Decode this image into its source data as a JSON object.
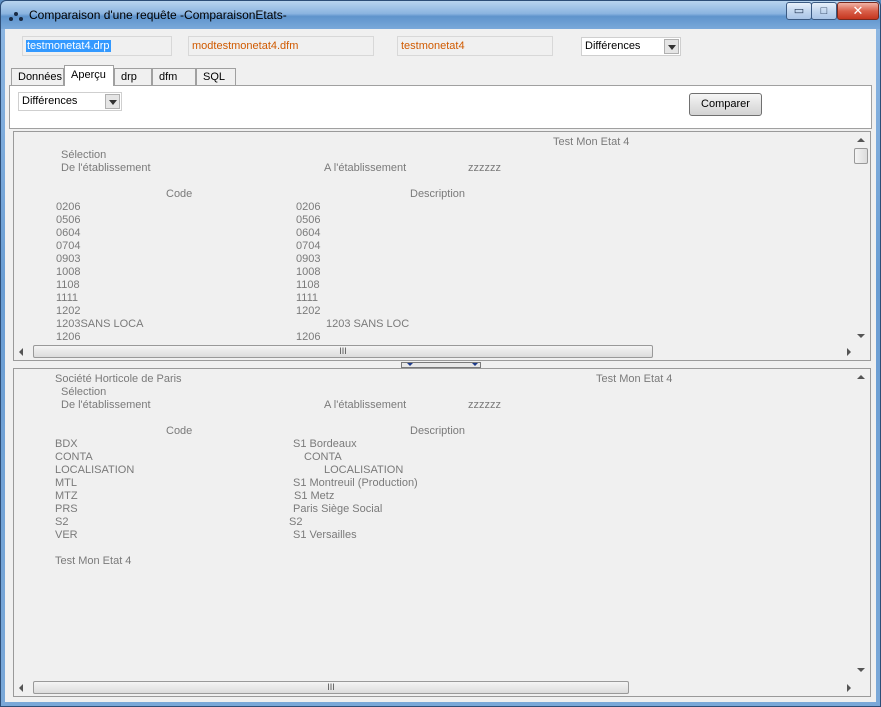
{
  "window": {
    "title": "Comparaison d'une requête -ComparaisonEtats-",
    "min_glyph": "▭",
    "max_glyph": "□",
    "close_glyph": "✕"
  },
  "fields": {
    "file1": "testmonetat4.drp",
    "file2": "modtestmonetat4.dfm",
    "file3": "testmonetat4",
    "mode_select": "Différences"
  },
  "tabs": [
    {
      "label": "Données"
    },
    {
      "label": "Aperçu"
    },
    {
      "label": "drp"
    },
    {
      "label": "dfm"
    },
    {
      "label": "SQL"
    }
  ],
  "toolbar": {
    "filter_select": "Différences",
    "compare_button": "Comparer"
  },
  "scroll_glyph": "III",
  "report_top": {
    "header_title": "Test Mon Etat 4",
    "selection_label": "Sélection",
    "from_label": "De l'établissement",
    "to_label": "A l'établissement",
    "to_value": "zzzzzz",
    "col_code": "Code",
    "col_description": "Description",
    "rows": [
      {
        "code": "0206",
        "desc": "0206"
      },
      {
        "code": "0506",
        "desc": "0506"
      },
      {
        "code": "0604",
        "desc": "0604"
      },
      {
        "code": "0704",
        "desc": "0704"
      },
      {
        "code": "0903",
        "desc": "0903"
      },
      {
        "code": "1008",
        "desc": "1008"
      },
      {
        "code": "1108",
        "desc": "1108"
      },
      {
        "code": "1111",
        "desc": "1111"
      },
      {
        "code": "1202",
        "desc": "1202"
      },
      {
        "code": "1203SANS LOCA",
        "desc": "1203 SANS LOC"
      },
      {
        "code": "1206",
        "desc": "1206"
      }
    ]
  },
  "report_bottom": {
    "company": "Société Horticole de Paris",
    "header_title": "Test Mon Etat 4",
    "selection_label": "Sélection",
    "from_label": "De l'établissement",
    "to_label": "A l'établissement",
    "to_value": "zzzzzz",
    "col_code": "Code",
    "col_description": "Description",
    "rows": [
      {
        "code": "BDX",
        "desc": "S1 Bordeaux"
      },
      {
        "code": "CONTA",
        "desc": "CONTA"
      },
      {
        "code": "LOCALISATION",
        "desc": "LOCALISATION"
      },
      {
        "code": "MTL",
        "desc": "S1 Montreuil (Production)"
      },
      {
        "code": "MTZ",
        "desc": "S1 Metz"
      },
      {
        "code": "PRS",
        "desc": "Paris Siège Social"
      },
      {
        "code": "S2",
        "desc": "S2"
      },
      {
        "code": "VER",
        "desc": "S1 Versailles"
      }
    ],
    "footer_title": "Test Mon Etat 4"
  }
}
